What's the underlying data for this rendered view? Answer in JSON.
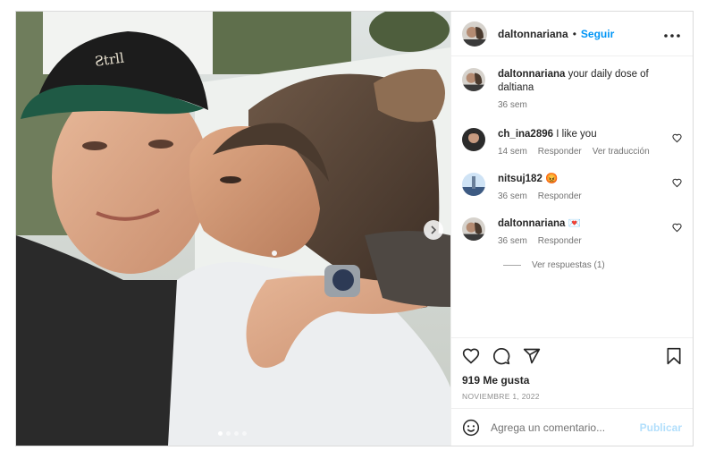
{
  "post": {
    "username": "daltonnariana",
    "separator": "•",
    "follow_label": "Seguir",
    "more_icon": "more-horizontal-icon",
    "images_count": 4,
    "active_image": 1
  },
  "caption": {
    "username": "daltonnariana",
    "text": "your daily dose of daltiana",
    "time": "36 sem"
  },
  "comments": [
    {
      "username": "ch_ina2896",
      "text": "I like you",
      "time": "14 sem",
      "reply": "Responder",
      "translate": "Ver traducción"
    },
    {
      "username": "nitsuj182",
      "text": "😡",
      "time": "36 sem",
      "reply": "Responder"
    },
    {
      "username": "daltonnariana",
      "text": "💌",
      "time": "36 sem",
      "reply": "Responder"
    }
  ],
  "view_replies": "Ver respuestas (1)",
  "likes": "919 Me gusta",
  "date": "NOVIEMBRE 1, 2022",
  "add_comment": {
    "placeholder": "Agrega un comentario...",
    "publish_label": "Publicar"
  },
  "colors": {
    "accent": "#0095f6",
    "publish_disabled": "#b2dffc",
    "muted": "#737373"
  }
}
